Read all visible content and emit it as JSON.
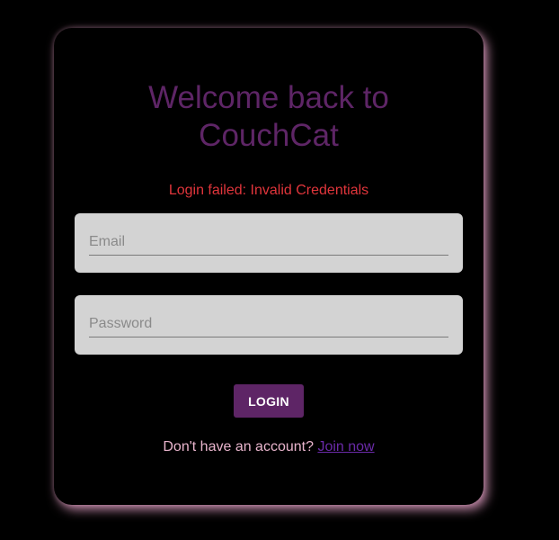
{
  "login": {
    "title_line1": "Welcome back to",
    "title_line2": "CouchCat",
    "error_message": "Login failed: Invalid Credentials",
    "email_placeholder": "Email",
    "password_placeholder": "Password",
    "login_button_label": "LOGIN",
    "signup_prompt": "Don't have an account?",
    "signup_link_label": "Join now"
  },
  "colors": {
    "background": "#000000",
    "title": "#5e2566",
    "error": "#e0353b",
    "field_background": "#d3d3d3",
    "button_background": "#5e2566",
    "button_text": "#ffffff",
    "prompt_text": "#e8b4cc",
    "link": "#6a2aa8",
    "card_glow": "#e2a0c4"
  }
}
